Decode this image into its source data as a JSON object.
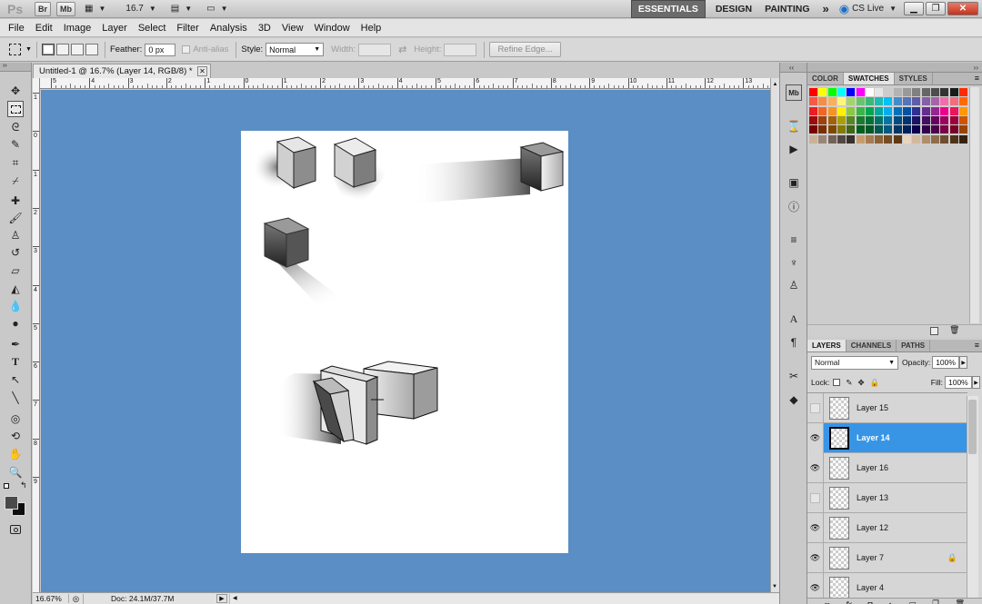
{
  "app": {
    "logo": "Ps",
    "bridge_label": "Br",
    "minibridge_label": "Mb",
    "zoom_field": "16.7",
    "workspaces": [
      "ESSENTIALS",
      "DESIGN",
      "PAINTING"
    ],
    "more_workspaces": "»",
    "cslive": "CS Live"
  },
  "menu": [
    "File",
    "Edit",
    "Image",
    "Layer",
    "Select",
    "Filter",
    "Analysis",
    "3D",
    "View",
    "Window",
    "Help"
  ],
  "options": {
    "feather_label": "Feather:",
    "feather_value": "0 px",
    "antialias_label": "Anti-alias",
    "style_label": "Style:",
    "style_value": "Normal",
    "width_label": "Width:",
    "height_label": "Height:",
    "refine_label": "Refine Edge..."
  },
  "document": {
    "tab_title": "Untitled-1 @ 16.7% (Layer 14, RGB/8) *",
    "ruler_marks": [
      "5",
      "4",
      "3",
      "2",
      "1",
      "0",
      "1",
      "2",
      "3",
      "4",
      "5",
      "6",
      "7",
      "8",
      "9",
      "10",
      "11",
      "12",
      "13"
    ],
    "vruler_marks": [
      "1",
      "0",
      "1",
      "2",
      "3",
      "4",
      "5",
      "6",
      "7",
      "8",
      "9"
    ],
    "status_zoom": "16.67%",
    "status_doc": "Doc: 24.1M/37.7M"
  },
  "panels": {
    "swatch_tabs": [
      "COLOR",
      "SWATCHES",
      "STYLES"
    ],
    "layer_tabs": [
      "LAYERS",
      "CHANNELS",
      "PATHS"
    ],
    "blend_mode": "Normal",
    "opacity_label": "Opacity:",
    "opacity_value": "100%",
    "lock_label": "Lock:",
    "fill_label": "Fill:",
    "fill_value": "100%"
  },
  "colors": {
    "canvas_bg": "#5a8ec4",
    "selected_layer": "#3895e6",
    "essentials_bg": "#6b6b6b"
  },
  "swatch_rows": [
    [
      "#ff0000",
      "#ffff00",
      "#00ff00",
      "#00ffff",
      "#0000ff",
      "#ff00ff",
      "#ffffff",
      "#e6e6e6",
      "#cccccc",
      "#b3b3b3",
      "#999999",
      "#808080",
      "#666666",
      "#4d4d4d",
      "#333333",
      "#1a1a1a",
      "#ff2a00"
    ],
    [
      "#f25b45",
      "#f58c4a",
      "#fbaf5d",
      "#fff57d",
      "#a3d46b",
      "#6ac26d",
      "#3cb878",
      "#1cbbb4",
      "#00bff3",
      "#438ccb",
      "#5574b9",
      "#605ca8",
      "#8560a8",
      "#a763a8",
      "#f06ea9",
      "#f26d7d",
      "#ff6a00"
    ],
    [
      "#ed1c24",
      "#f26522",
      "#f7941d",
      "#fff200",
      "#8dc63f",
      "#39b54a",
      "#00a651",
      "#00a99d",
      "#00aeef",
      "#0072bc",
      "#0054a6",
      "#2e3192",
      "#662d91",
      "#92278f",
      "#ec008c",
      "#ed145b",
      "#ff9900"
    ],
    [
      "#9e0b0f",
      "#a0410d",
      "#a36209",
      "#aba000",
      "#598527",
      "#1a7b30",
      "#007236",
      "#00746b",
      "#0076a3",
      "#004b80",
      "#003471",
      "#1b1464",
      "#440e62",
      "#630460",
      "#9e005d",
      "#9e0039",
      "#cc5500"
    ],
    [
      "#790000",
      "#7b2e00",
      "#7d4900",
      "#827b00",
      "#406618",
      "#005e20",
      "#005826",
      "#005952",
      "#005b7f",
      "#003663",
      "#002157",
      "#0d004c",
      "#32004b",
      "#4b0049",
      "#7b0046",
      "#7a0026",
      "#994400"
    ],
    [
      "#c7b299",
      "#998675",
      "#736357",
      "#534741",
      "#37302d",
      "#c69c6d",
      "#a67c52",
      "#8c6239",
      "#754c24",
      "#603913",
      "#e8d5c0",
      "#d4b89c",
      "#b08d6b",
      "#8f6c4a",
      "#6e4e2e",
      "#4e3318",
      "#332211"
    ]
  ],
  "layers": [
    {
      "name": "Layer 15",
      "visible": false,
      "selected": false,
      "locked": false
    },
    {
      "name": "Layer 14",
      "visible": true,
      "selected": true,
      "locked": false
    },
    {
      "name": "Layer 16",
      "visible": true,
      "selected": false,
      "locked": false
    },
    {
      "name": "Layer 13",
      "visible": false,
      "selected": false,
      "locked": false
    },
    {
      "name": "Layer 12",
      "visible": true,
      "selected": false,
      "locked": false
    },
    {
      "name": "Layer 7",
      "visible": true,
      "selected": false,
      "locked": true
    },
    {
      "name": "Layer 4",
      "visible": true,
      "selected": false,
      "locked": false
    }
  ]
}
